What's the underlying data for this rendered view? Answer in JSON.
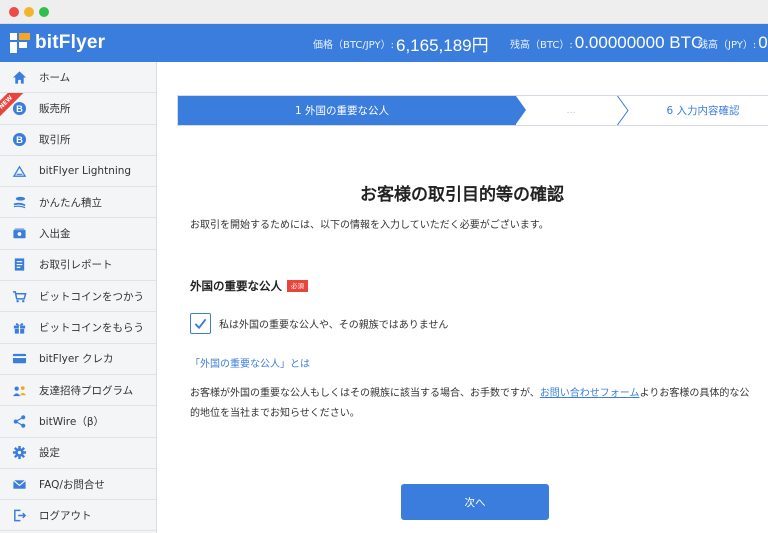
{
  "header": {
    "brand": "bitFlyer",
    "price_label": "価格（BTC/JPY）:",
    "price_value": "6,165,189円",
    "btc_label": "残高（BTC）:",
    "btc_value": "0.00000000 BTC",
    "jpy_label": "残高（JPY）:",
    "jpy_value": "0"
  },
  "sidebar": {
    "new_badge": "NEW",
    "items": [
      {
        "label": "ホーム",
        "icon": "home-icon"
      },
      {
        "label": "販売所",
        "icon": "bitcoin-icon"
      },
      {
        "label": "取引所",
        "icon": "bitcoin-icon"
      },
      {
        "label": "bitFlyer Lightning",
        "icon": "lightning-icon"
      },
      {
        "label": "かんたん積立",
        "icon": "coin-stack-icon"
      },
      {
        "label": "入出金",
        "icon": "wallet-icon"
      },
      {
        "label": "お取引レポート",
        "icon": "report-icon"
      },
      {
        "label": "ビットコインをつかう",
        "icon": "cart-icon"
      },
      {
        "label": "ビットコインをもらう",
        "icon": "gift-icon"
      },
      {
        "label": "bitFlyer クレカ",
        "icon": "credit-card-icon"
      },
      {
        "label": "友達招待プログラム",
        "icon": "friends-icon"
      },
      {
        "label": "bitWire（β）",
        "icon": "share-icon"
      },
      {
        "label": "設定",
        "icon": "gear-icon"
      },
      {
        "label": "FAQ/お問合せ",
        "icon": "mail-icon"
      },
      {
        "label": "ログアウト",
        "icon": "logout-icon"
      }
    ]
  },
  "steps": {
    "current": "1 外国の重要な公人",
    "middle": "…",
    "last": "6 入力内容確認"
  },
  "main": {
    "title": "お客様の取引目的等の確認",
    "intro": "お取引を開始するためには、以下の情報を入力していただく必要がございます。",
    "section_title": "外国の重要な公人",
    "required_badge": "必須",
    "checkbox_label": "私は外国の重要な公人や、その親族ではありません",
    "checkbox_checked": true,
    "pep_link": "「外国の重要な公人」とは",
    "desc_before": "お客様が外国の重要な公人もしくはその親族に該当する場合、お手数ですが、",
    "desc_link": "お問い合わせフォーム",
    "desc_after": "よりお客様の具体的な公的地位を当社までお知らせください。",
    "next_button": "次へ"
  },
  "colors": {
    "brand_blue": "#3b7ddd",
    "required_red": "#e8453c"
  }
}
